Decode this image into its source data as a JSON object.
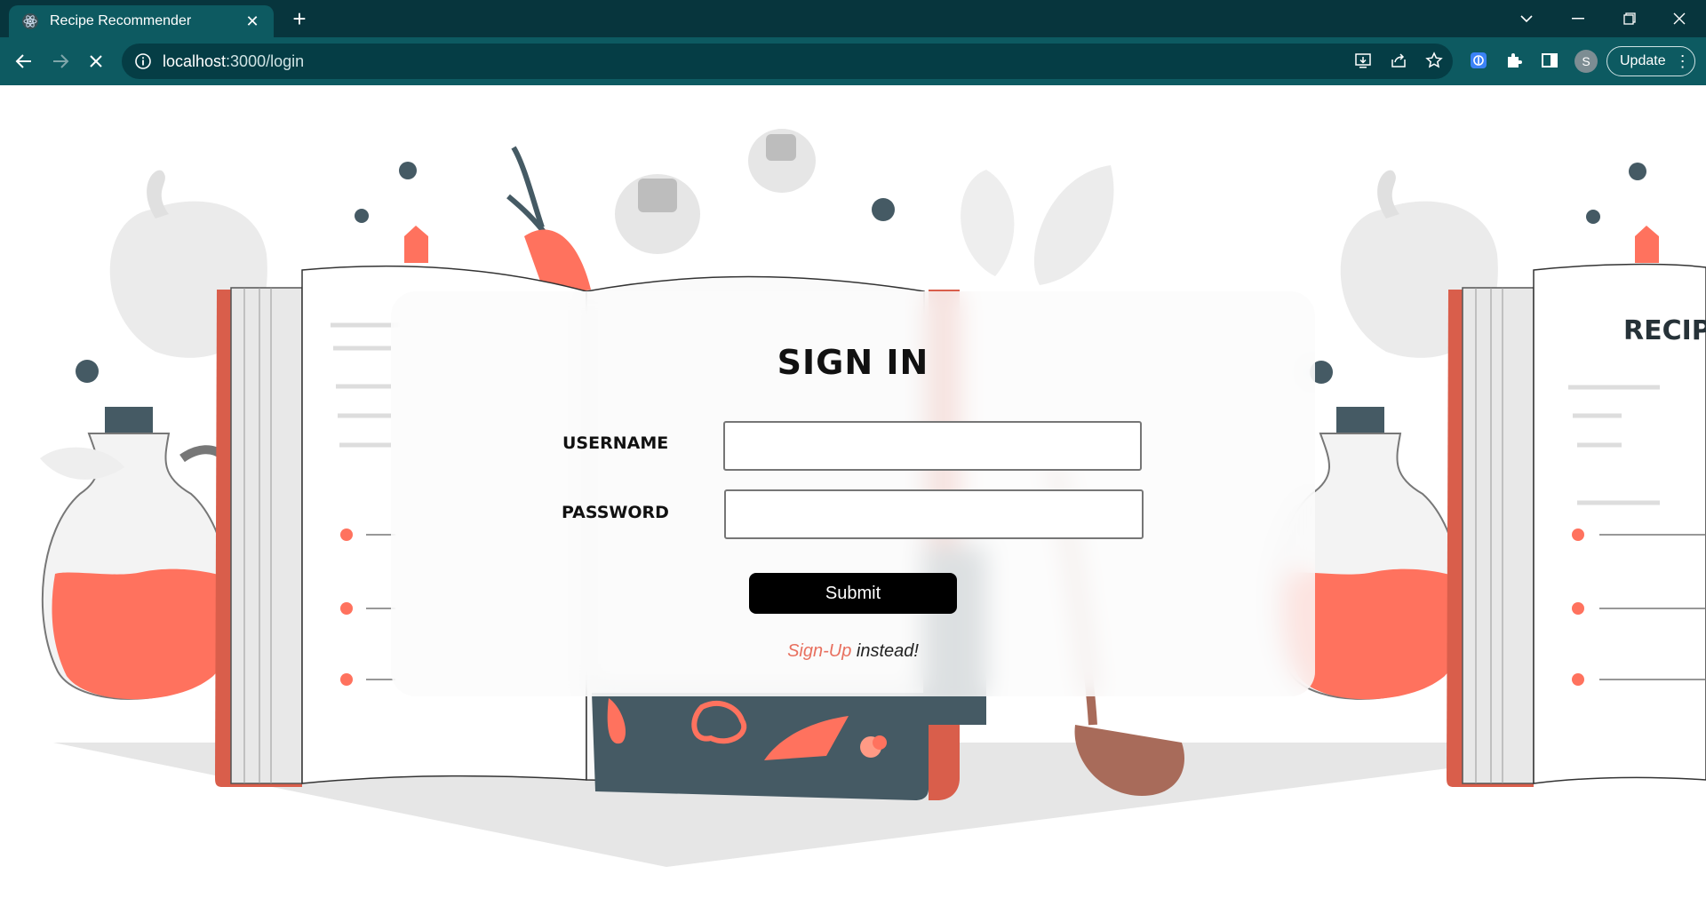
{
  "browser": {
    "tab_title": "Recipe Recommender",
    "url_host": "localhost",
    "url_path": ":3000/login",
    "profile_initial": "S",
    "update_label": "Update"
  },
  "login": {
    "title": "SIGN IN",
    "username_label": "USERNAME",
    "password_label": "PASSWORD",
    "username_value": "",
    "password_value": "",
    "submit_label": "Submit",
    "signup_link": "Sign-Up",
    "signup_suffix": " instead!"
  },
  "illustration": {
    "book_title": "RECIPE"
  },
  "colors": {
    "chrome_dark": "#07353d",
    "chrome_toolbar": "#0d5a61",
    "accent_coral": "#ff725e",
    "book_red": "#d95e4b",
    "slate": "#455a64"
  }
}
